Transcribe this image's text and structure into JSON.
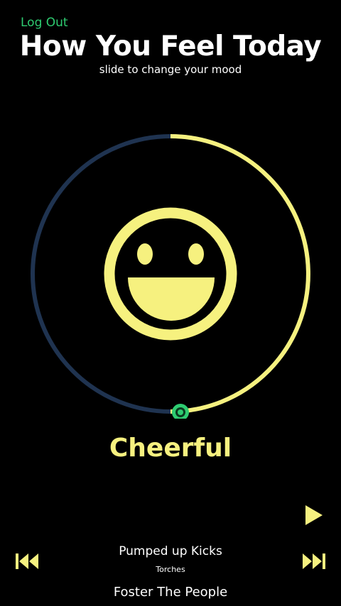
{
  "header": {
    "logout_label": "Log Out",
    "title": "How You Feel Today",
    "subtitle": "slide to change your mood"
  },
  "mood": {
    "label": "Cheerful",
    "level": 0.5,
    "face_icon": "smiley-face-icon"
  },
  "player": {
    "song_title": "Pumped up Kicks",
    "album": "Torches",
    "artist": "Foster The People",
    "play_icon": "play-icon",
    "prev_icon": "skip-previous-icon",
    "next_icon": "skip-next-icon"
  },
  "colors": {
    "background": "#000000",
    "accent_yellow": "#f6f17f",
    "track_navy": "#1f3350",
    "logout_green": "#2ecc71",
    "handle_green": "#2ecc71"
  }
}
